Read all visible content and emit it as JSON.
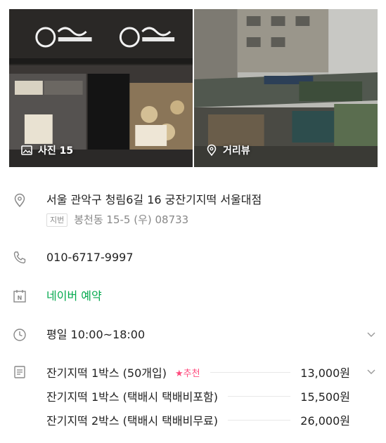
{
  "photos": [
    {
      "label": "사진 15",
      "icon": "image-icon"
    },
    {
      "label": "거리뷰",
      "icon": "location-pin-icon"
    }
  ],
  "address": {
    "road": "서울 관악구 청림6길 16 궁잔기지떡 서울대점",
    "jibun_tag": "지번",
    "jibun": "봉천동 15-5 (우) 08733"
  },
  "phone": "010-6717-9997",
  "reservation": {
    "label": "네이버 예약",
    "color": "#03a94d",
    "icon_text": "N"
  },
  "hours": "평일 10:00~18:00",
  "menu": [
    {
      "name": "잔기지떡 1박스 (50개입)",
      "badge": "★추천",
      "price": "13,000원"
    },
    {
      "name": "잔기지떡 1박스 (택배시 택배비포함)",
      "badge": "",
      "price": "15,500원"
    },
    {
      "name": "잔기지떡 2박스 (택배시 택배비무료)",
      "badge": "",
      "price": "26,000원"
    }
  ],
  "colors": {
    "accent_green": "#03a94d",
    "recommend_pink": "#ff4b7d",
    "icon_gray": "#888888"
  }
}
